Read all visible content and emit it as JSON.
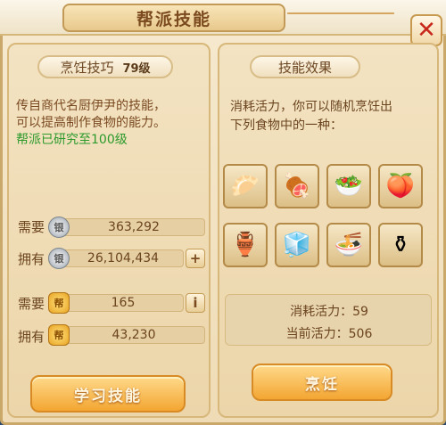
{
  "window": {
    "title": "帮派技能",
    "close_icon": "close-icon"
  },
  "skill": {
    "name": "烹饪技巧",
    "level": "79级",
    "description_line1": "传自商代名厨伊尹的技能，",
    "description_line2": "可以提高制作食物的能力。",
    "guild_research": "帮派已研究至100级"
  },
  "costs": {
    "silver_need_label": "需要",
    "silver_need_value": "363,292",
    "silver_have_label": "拥有",
    "silver_have_value": "26,104,434",
    "add_button": "+",
    "gold_need_label": "需要",
    "gold_need_value": "165",
    "info_button": "i",
    "gold_have_label": "拥有",
    "gold_have_value": "43,230",
    "silver_icon": "silver-coin-icon",
    "gold_icon": "gold-contribution-icon"
  },
  "learn_button": "学习技能",
  "effect": {
    "header": "技能效果",
    "description_line1": "消耗活力，你可以随机烹饪出",
    "description_line2": "下列食物中的一种：",
    "foods": [
      {
        "icon": "steamed-buns-icon",
        "glyph": "🥟"
      },
      {
        "icon": "braised-pork-icon",
        "glyph": "🍖"
      },
      {
        "icon": "vegetable-bowl-icon",
        "glyph": "🥗"
      },
      {
        "icon": "peach-bun-icon",
        "glyph": "🍑"
      },
      {
        "icon": "bronze-wine-vessel-icon",
        "glyph": "🏺"
      },
      {
        "icon": "green-jelly-icon",
        "glyph": "🧊"
      },
      {
        "icon": "noodle-bowl-icon",
        "glyph": "🍜"
      },
      {
        "icon": "bronze-tripod-icon",
        "glyph": "⚱"
      }
    ],
    "energy_cost": "消耗活力：59",
    "energy_current": "当前活力：506"
  },
  "cook_button": "烹饪"
}
